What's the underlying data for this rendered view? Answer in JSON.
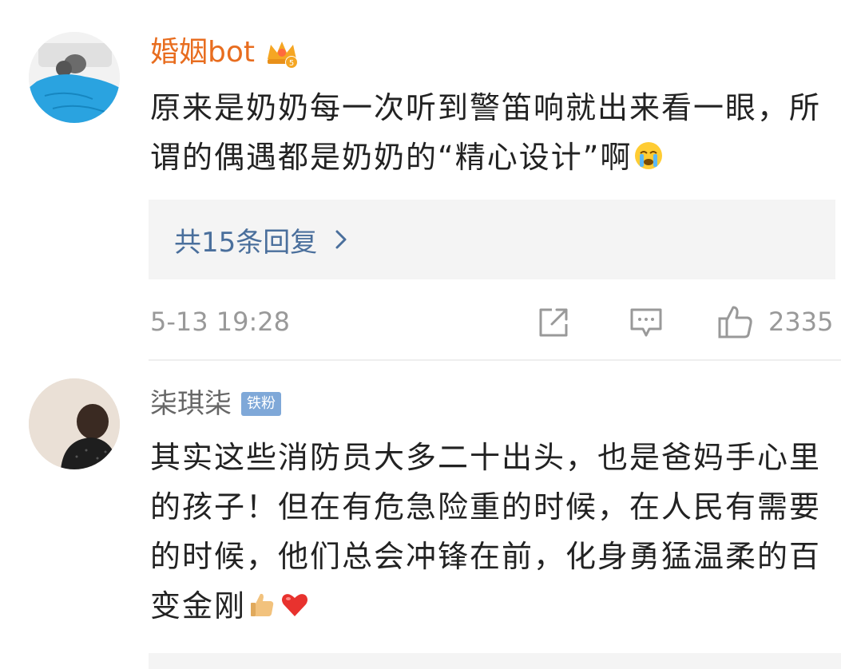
{
  "comments": [
    {
      "username": "婚姻bot",
      "text": "原来是奶奶每一次听到警笛响就出来看一眼，所谓的偶遇都是奶奶的“精心设计”啊",
      "replies_label": "共15条回复",
      "timestamp": "5-13 19:28",
      "likes": "2335",
      "icons": {
        "badge": "crown-icon",
        "emoji": "crying-emoji",
        "share": "share-icon",
        "reply": "reply-icon",
        "like": "thumbs-up-icon"
      },
      "colors": {
        "username": "#e86d1f",
        "link": "#4a6f9c"
      }
    },
    {
      "username": "柒琪柒",
      "badge": "铁粉",
      "text": "其实这些消防员大多二十出头，也是爸妈手心里的孩子！但在有危急险重的时候，在人民有需要的时候，他们总会冲锋在前，化身勇猛温柔的百变金刚",
      "icons": {
        "emoji_1": "thumbs-up-emoji",
        "emoji_2": "red-heart-emoji"
      },
      "colors": {
        "badge": "#7fa8d8"
      }
    }
  ]
}
